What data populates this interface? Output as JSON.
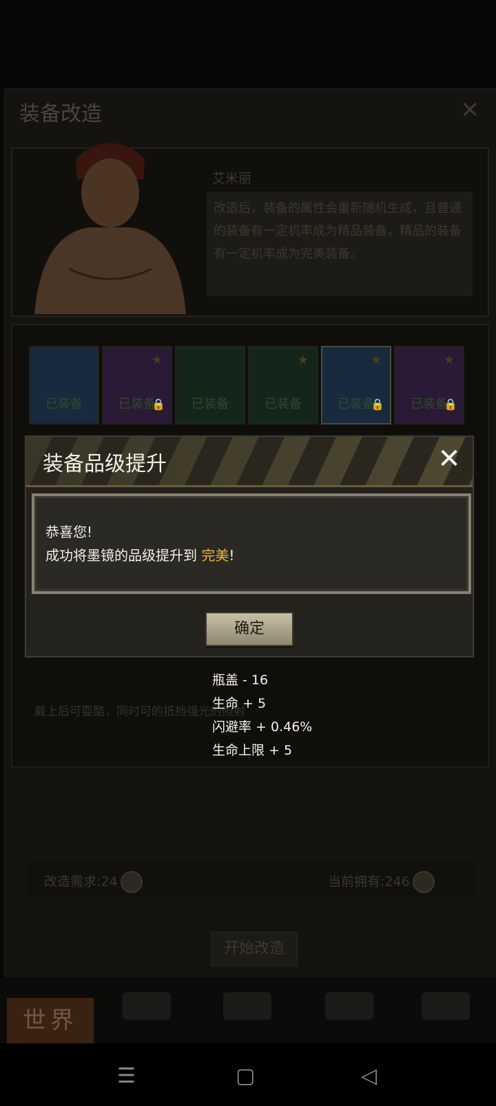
{
  "background": {
    "title": "装备改造",
    "close_icon": "close-icon",
    "npc": {
      "name": "艾米丽",
      "speech": "改造后，装备的属性会重新随机生成，且普通的装备有一定机率成为精品装备，精品的装备有一定机率成为完美装备。"
    },
    "equipment_slots": [
      {
        "label": "已装备",
        "starred": false,
        "locked": false,
        "color": "#172a3e"
      },
      {
        "label": "已装备",
        "starred": true,
        "locked": true,
        "color": "#2a1a35"
      },
      {
        "label": "已装备",
        "starred": false,
        "locked": false,
        "color": "#14261a"
      },
      {
        "label": "已装备",
        "starred": true,
        "locked": false,
        "color": "#14261a"
      },
      {
        "label": "已装备",
        "starred": true,
        "locked": true,
        "color": "#172a3e"
      },
      {
        "label": "已装备",
        "starred": true,
        "locked": true,
        "color": "#2a1a35"
      }
    ],
    "description": "戴上后可耍酷，同时可的抵挡强光的照射",
    "requirement": "改造需求:24",
    "owned": "当前拥有:246",
    "start_button": "开始改造",
    "nav": {
      "world": "世界"
    }
  },
  "modal": {
    "title": "装备品级提升",
    "line1": "恭喜您!",
    "line2_prefix": "成功将墨镜的品级提升到 ",
    "quality": "完美",
    "line2_suffix": "!",
    "confirm_label": "确定",
    "accent_color": "#f0b430"
  },
  "stats": [
    "瓶盖 - 16",
    "生命 + 5",
    "闪避率 + 0.46%",
    "生命上限 + 5"
  ]
}
